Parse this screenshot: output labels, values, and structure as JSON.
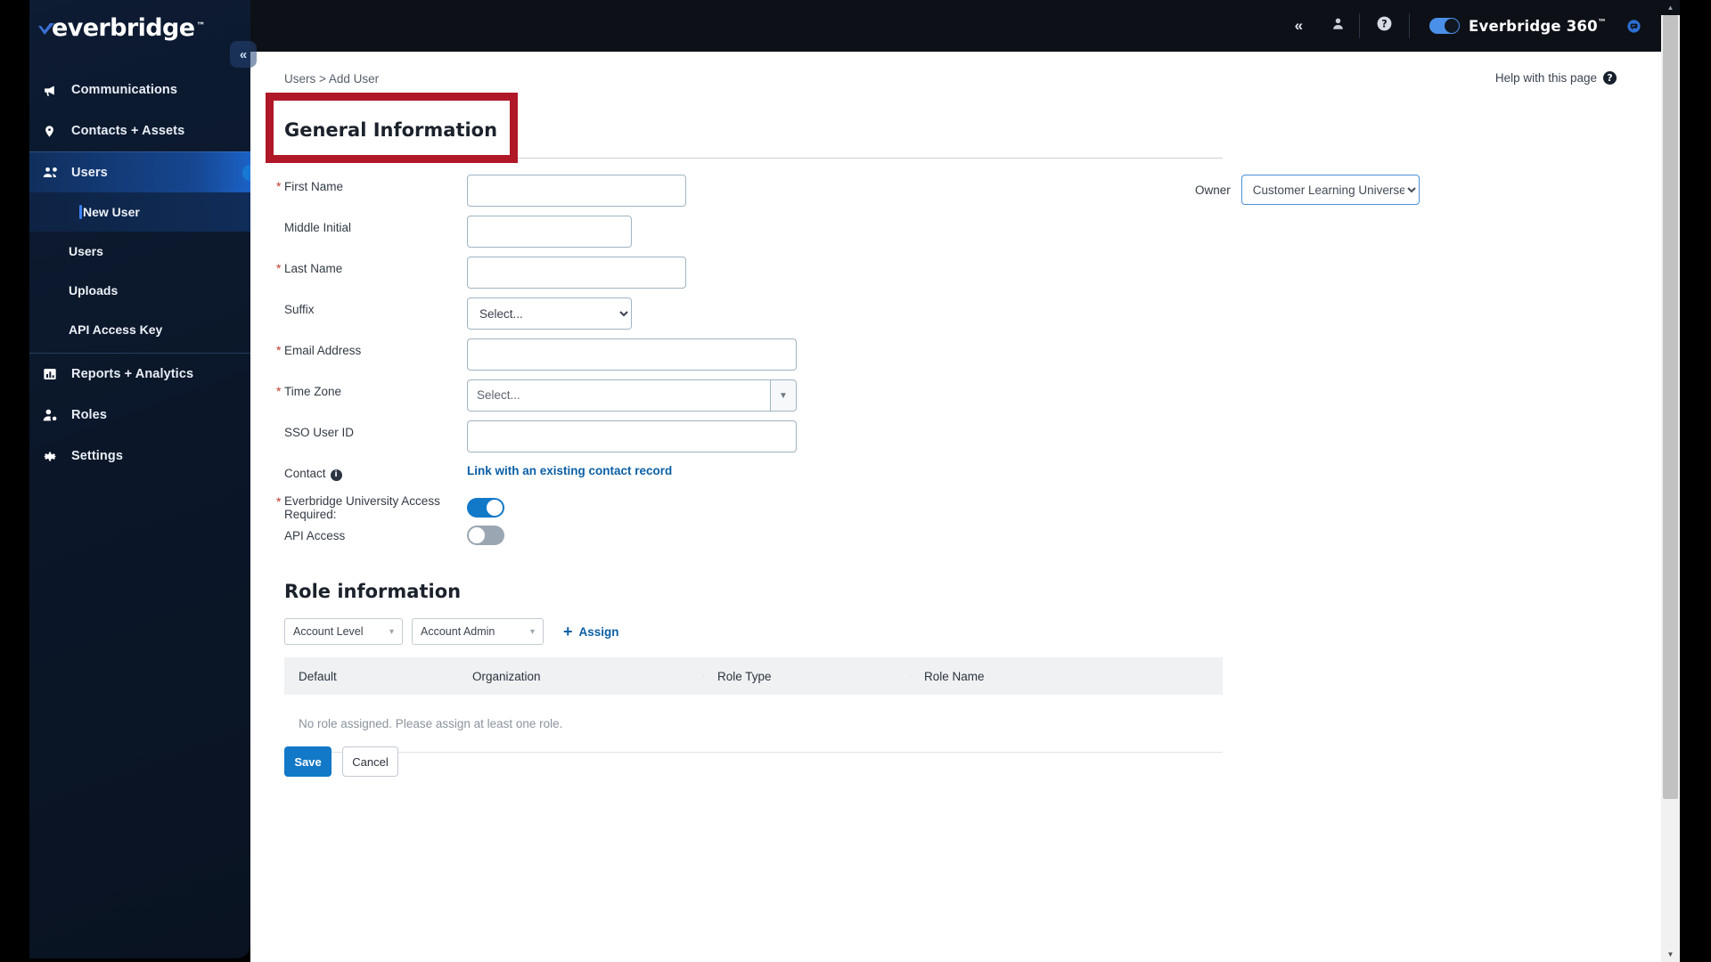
{
  "sidebar": {
    "logo_text": "everbridge",
    "logo_tm": "™",
    "collapse_icon": "«",
    "items": [
      {
        "label": "Communications",
        "icon": "megaphone-icon"
      },
      {
        "label": "Contacts + Assets",
        "icon": "location-pin-icon"
      },
      {
        "label": "Users",
        "icon": "people-icon",
        "active": true
      },
      {
        "label": "Reports + Analytics",
        "icon": "bar-chart-icon"
      },
      {
        "label": "Roles",
        "icon": "user-gear-icon"
      },
      {
        "label": "Settings",
        "icon": "gear-icon"
      }
    ],
    "sub_items": [
      {
        "label": "New User",
        "current": true
      },
      {
        "label": "Users",
        "current": false
      },
      {
        "label": "Uploads",
        "current": false
      },
      {
        "label": "API Access Key",
        "current": false
      }
    ]
  },
  "topbar": {
    "collapse_icon": "«",
    "account_icon": "person-icon",
    "help_icon": "help-circle-icon",
    "brand_label": "Everbridge 360",
    "brand_tm": "™",
    "chat_icon": "chat-bubble-icon",
    "toggle_on": true
  },
  "page": {
    "breadcrumb": "Users > Add User",
    "help_link": "Help with this page",
    "help_icon_glyph": "?"
  },
  "general_information": {
    "title": "General Information",
    "owner_label": "Owner",
    "owner_value": "Customer Learning Universe",
    "owner_options": [
      "Customer Learning Universe"
    ],
    "fields": [
      {
        "label": "First Name",
        "required": true,
        "value": "",
        "type": "text"
      },
      {
        "label": "Middle Initial",
        "required": false,
        "value": "",
        "type": "text"
      },
      {
        "label": "Last Name",
        "required": true,
        "value": "",
        "type": "text"
      },
      {
        "label": "Suffix",
        "required": false,
        "value": "Select...",
        "type": "select",
        "options": [
          "Select..."
        ]
      },
      {
        "label": "Email Address",
        "required": true,
        "value": "",
        "type": "text"
      },
      {
        "label": "Time Zone",
        "required": true,
        "value": "Select...",
        "type": "combo"
      },
      {
        "label": "SSO User ID",
        "required": false,
        "value": "",
        "type": "text"
      }
    ],
    "contact_label": "Contact",
    "contact_info_glyph": "i",
    "contact_link": "Link with an existing contact record",
    "eu_access_label": "Everbridge University Access Required:",
    "eu_access_required": true,
    "eu_access_on": true,
    "api_access_label": "API Access",
    "api_access_on": false
  },
  "role_information": {
    "title": "Role information",
    "level_select": "Account Level",
    "role_select": "Account Admin",
    "assign_label": "Assign",
    "assign_icon": "plus-icon",
    "columns": [
      "Default",
      "Organization",
      "Role Type",
      "Role Name"
    ],
    "empty_message": "No role assigned. Please assign at least one role.",
    "rows": []
  },
  "actions": {
    "save_label": "Save",
    "cancel_label": "Cancel"
  },
  "annotation": {
    "highlight_color": "#b01828",
    "target": "General Information"
  }
}
